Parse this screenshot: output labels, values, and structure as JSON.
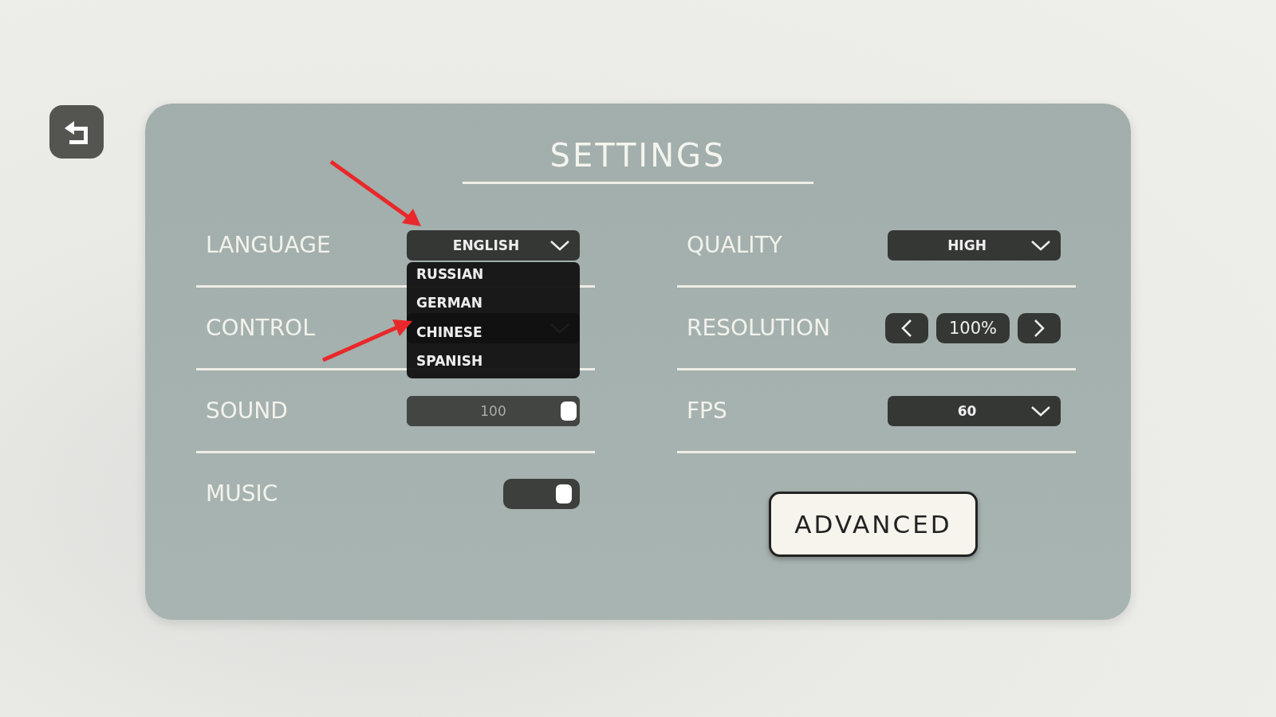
{
  "title": "SETTINGS",
  "left": [
    {
      "kind": "dropdown",
      "label": "LANGUAGE",
      "value": "ENGLISH",
      "open": true,
      "options": [
        "RUSSIAN",
        "GERMAN",
        "CHINESE",
        "SPANISH"
      ]
    },
    {
      "kind": "dropdown",
      "label": "CONTROL"
    },
    {
      "kind": "slider",
      "label": "SOUND",
      "value": "100",
      "level": 1
    },
    {
      "kind": "toggle",
      "label": "MUSIC",
      "on": true
    }
  ],
  "right": [
    {
      "kind": "dropdown",
      "label": "QUALITY",
      "value": "HIGH"
    },
    {
      "kind": "stepper",
      "label": "RESOLUTION",
      "value": "100%"
    },
    {
      "kind": "dropdown",
      "label": "FPS",
      "value": "60"
    }
  ],
  "advanced_button": "ADVANCED"
}
